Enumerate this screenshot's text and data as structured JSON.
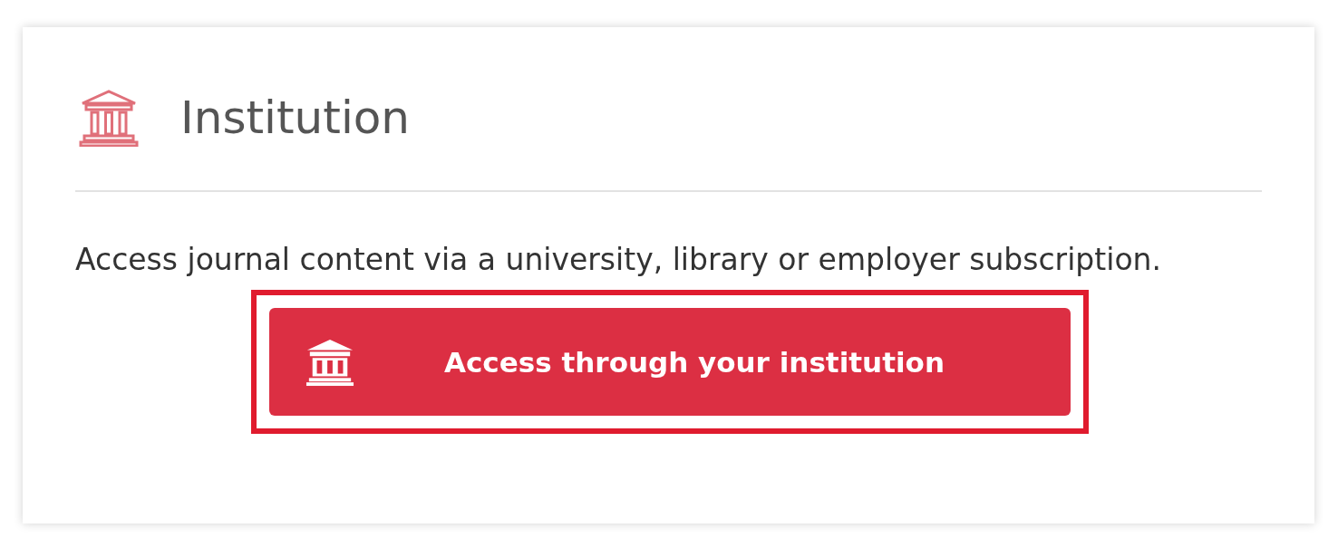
{
  "panel": {
    "title": "Institution",
    "description": "Access journal content via a university, library or employer subscription.",
    "button": {
      "label": "Access through your institution",
      "focused": true
    }
  }
}
